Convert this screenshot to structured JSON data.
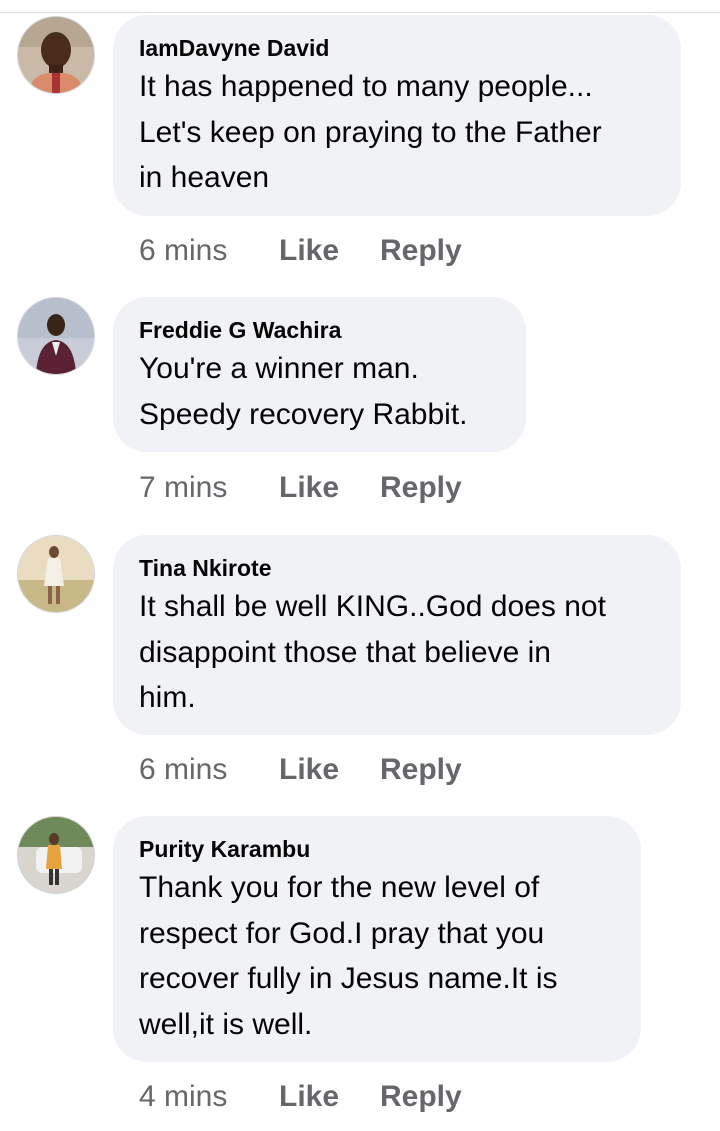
{
  "comments": [
    {
      "author": "IamDavyne David",
      "text_lines": [
        "It has happened to many people...",
        "Let's keep on praying to the Father",
        "in heaven"
      ],
      "time": "6 mins",
      "like_label": "Like",
      "reply_label": "Reply"
    },
    {
      "author": "Freddie G Wachira",
      "text_lines": [
        "You're a winner man.",
        "Speedy recovery Rabbit."
      ],
      "time": "7 mins",
      "like_label": "Like",
      "reply_label": "Reply"
    },
    {
      "author": "Tina Nkirote",
      "text_lines": [
        "It shall be well KING..God does not",
        "disappoint those that believe in",
        "him."
      ],
      "time": "6 mins",
      "like_label": "Like",
      "reply_label": "Reply"
    },
    {
      "author": "Purity Karambu",
      "text_lines": [
        "Thank you for the new level of",
        "respect for God.I pray that you",
        "recover fully in Jesus name.It is",
        "well,it is well."
      ],
      "time": "4 mins",
      "like_label": "Like",
      "reply_label": "Reply"
    }
  ],
  "colors": {
    "bubble_bg": "#f0f2f5",
    "meta_text": "#65676b",
    "primary_text": "#050505"
  }
}
